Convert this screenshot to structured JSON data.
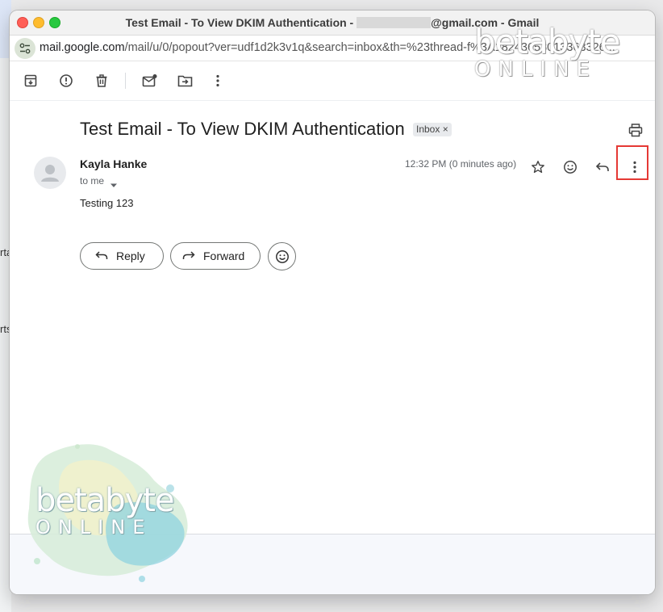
{
  "window": {
    "title_prefix": "Test Email - To View DKIM Authentication -",
    "title_suffix": "@gmail.com - Gmail"
  },
  "urlbar": {
    "host": "mail.google.com",
    "path": "/mail/u/0/popout?ver=udf1d2k3v1q&search=inbox&th=%23thread-f%3A18243653013363326..."
  },
  "toolbar": {
    "icons": [
      "archive-icon",
      "report-spam-icon",
      "delete-icon",
      "mark-unread-icon",
      "move-to-icon",
      "more-vert-icon"
    ]
  },
  "email": {
    "subject": "Test Email - To View DKIM Authentication",
    "label": "Inbox",
    "label_remove": "×",
    "sender": "Kayla Hanke",
    "to": "to me",
    "time": "12:32 PM (0 minutes ago)",
    "body": "Testing 123"
  },
  "actions": {
    "reply_label": "Reply",
    "forward_label": "Forward"
  },
  "background": {
    "fragment_1": "rta",
    "fragment_2": "rts"
  },
  "watermark": {
    "line1": "betabyte",
    "line2": "ONLINE"
  },
  "colors": {
    "highlight": "#e53935",
    "traffic_red": "#ff5f57",
    "traffic_yellow": "#febc2e",
    "traffic_green": "#28c840"
  }
}
